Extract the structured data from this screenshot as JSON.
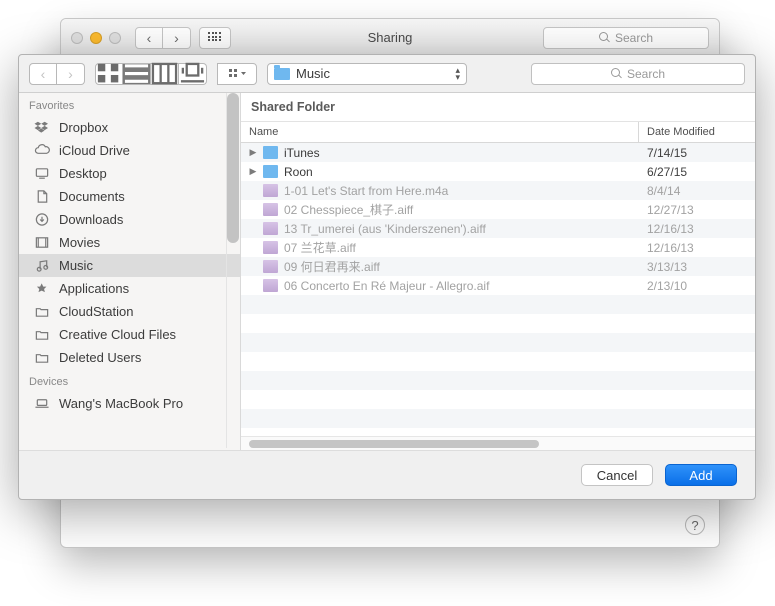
{
  "bgWindow": {
    "title": "Sharing",
    "searchPlaceholder": "Search"
  },
  "sheet": {
    "navBackDisabled": true,
    "navFwdDisabled": true,
    "viewMode": "list",
    "pathLabel": "Music",
    "searchPlaceholder": "Search",
    "sharedFolderTitle": "Shared Folder",
    "headers": {
      "name": "Name",
      "date": "Date Modified"
    },
    "cancelLabel": "Cancel",
    "addLabel": "Add"
  },
  "sidebar": {
    "sections": [
      {
        "title": "Favorites",
        "items": [
          {
            "icon": "dropbox",
            "label": "Dropbox"
          },
          {
            "icon": "icloud",
            "label": "iCloud Drive"
          },
          {
            "icon": "desktop",
            "label": "Desktop"
          },
          {
            "icon": "documents",
            "label": "Documents"
          },
          {
            "icon": "downloads",
            "label": "Downloads"
          },
          {
            "icon": "movies",
            "label": "Movies"
          },
          {
            "icon": "music",
            "label": "Music",
            "active": true
          },
          {
            "icon": "apps",
            "label": "Applications"
          },
          {
            "icon": "folder",
            "label": "CloudStation"
          },
          {
            "icon": "folder",
            "label": "Creative Cloud Files"
          },
          {
            "icon": "folder",
            "label": "Deleted Users"
          }
        ]
      },
      {
        "title": "Devices",
        "items": [
          {
            "icon": "laptop",
            "label": "Wang's MacBook Pro"
          }
        ]
      }
    ]
  },
  "files": [
    {
      "folder": true,
      "name": "iTunes",
      "date": "7/14/15",
      "enabled": true
    },
    {
      "folder": true,
      "name": "Roon",
      "date": "6/27/15",
      "enabled": true
    },
    {
      "folder": false,
      "name": "1-01 Let's Start from Here.m4a",
      "date": "8/4/14",
      "enabled": false
    },
    {
      "folder": false,
      "name": "02 Chesspiece_棋子.aiff",
      "date": "12/27/13",
      "enabled": false
    },
    {
      "folder": false,
      "name": "13 Tr_umerei (aus 'Kinderszenen').aiff",
      "date": "12/16/13",
      "enabled": false
    },
    {
      "folder": false,
      "name": "07 兰花草.aiff",
      "date": "12/16/13",
      "enabled": false
    },
    {
      "folder": false,
      "name": "09 何日君再来.aiff",
      "date": "3/13/13",
      "enabled": false
    },
    {
      "folder": false,
      "name": "06 Concerto En Ré Majeur - Allegro.aif",
      "date": "2/13/10",
      "enabled": false
    }
  ]
}
